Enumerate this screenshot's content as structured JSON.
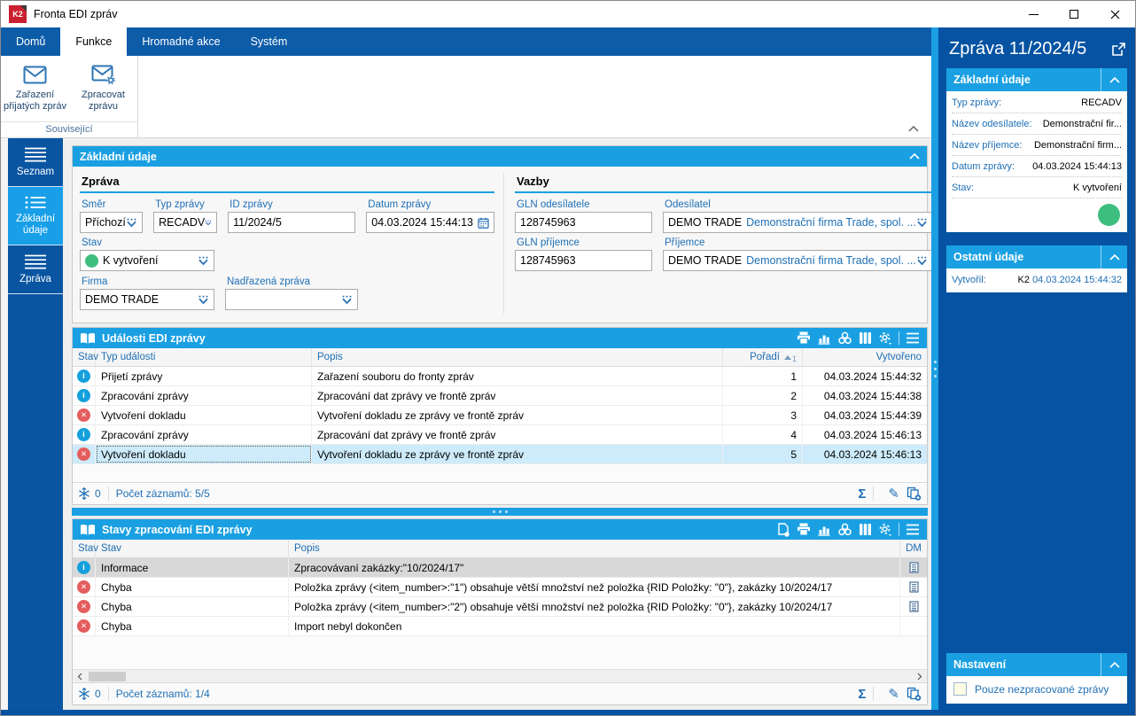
{
  "window": {
    "title": "Fronta EDI zpráv",
    "logo": "K2"
  },
  "ribbon": {
    "tabs": [
      {
        "label": "Domů",
        "active": false
      },
      {
        "label": "Funkce",
        "active": true
      },
      {
        "label": "Hromadné akce",
        "active": false
      },
      {
        "label": "Systém",
        "active": false
      }
    ],
    "group": {
      "label": "Související",
      "buttons": [
        {
          "label": "Zařazení přijatých zpráv",
          "icon": "envelope-icon"
        },
        {
          "label": "Zpracovat zprávu",
          "icon": "envelope-gear-icon"
        }
      ]
    }
  },
  "sidebar": {
    "items": [
      {
        "label": "Seznam",
        "icon": "menu-lines-icon",
        "active": false
      },
      {
        "label": "Základní údaje",
        "icon": "list-dots-icon",
        "active": true
      },
      {
        "label": "Zpráva",
        "icon": "menu-lines-icon",
        "active": false
      }
    ]
  },
  "form": {
    "title": "Základní údaje",
    "zprava": {
      "title": "Zpráva",
      "smer": {
        "label": "Směr",
        "value": "Příchozí"
      },
      "typ": {
        "label": "Typ zprávy",
        "value": "RECADV"
      },
      "id": {
        "label": "ID zprávy",
        "value": "11/2024/5"
      },
      "datum": {
        "label": "Datum zprávy",
        "value": "04.03.2024 15:44:13"
      },
      "stav": {
        "label": "Stav",
        "value": "K vytvoření",
        "status_color": "#3EBE7E"
      },
      "firma": {
        "label": "Firma",
        "value": "DEMO TRADE"
      },
      "nadrazena": {
        "label": "Nadřazená zpráva",
        "value": ""
      }
    },
    "vazby": {
      "title": "Vazby",
      "gln_odesilatele": {
        "label": "GLN odesílatele",
        "value": "128745963"
      },
      "odesilatel": {
        "label": "Odesílatel",
        "code": "DEMO TRADE",
        "name": "Demonstrační firma Trade, spol. ..."
      },
      "gln_prijemce": {
        "label": "GLN příjemce",
        "value": "128745963"
      },
      "prijemce": {
        "label": "Příjemce",
        "code": "DEMO TRADE",
        "name": "Demonstrační firma Trade, spol. ..."
      }
    }
  },
  "events_table": {
    "title": "Události EDI zprávy",
    "headers": {
      "stav": "Stav",
      "typ": "Typ události",
      "popis": "Popis",
      "poradi": "Pořadí",
      "vytvoreno": "Vytvořeno"
    },
    "sort_order": "1",
    "rows": [
      {
        "status": "info",
        "typ": "Přijetí zprávy",
        "popis": "Zařazení souboru do fronty zpráv",
        "poradi": "1",
        "vytvoreno": "04.03.2024 15:44:32",
        "selected": false
      },
      {
        "status": "info",
        "typ": "Zpracování zprávy",
        "popis": "Zpracování dat zprávy ve frontě zpráv",
        "poradi": "2",
        "vytvoreno": "04.03.2024 15:44:38",
        "selected": false
      },
      {
        "status": "error",
        "typ": "Vytvoření dokladu",
        "popis": "Vytvoření dokladu ze zprávy ve frontě zpráv",
        "poradi": "3",
        "vytvoreno": "04.03.2024 15:44:39",
        "selected": false
      },
      {
        "status": "info",
        "typ": "Zpracování zprávy",
        "popis": "Zpracování dat zprávy ve frontě zpráv",
        "poradi": "4",
        "vytvoreno": "04.03.2024 15:46:13",
        "selected": false
      },
      {
        "status": "error",
        "typ": "Vytvoření dokladu",
        "popis": "Vytvoření dokladu ze zprávy ve frontě zpráv",
        "poradi": "5",
        "vytvoreno": "04.03.2024 15:46:13",
        "selected": true
      }
    ],
    "footer": {
      "counter": "0",
      "records": "Počet záznamů: 5/5"
    },
    "toolbar_icons": [
      "printer-icon",
      "chart-icon",
      "wheel-icon",
      "columns-icon",
      "gear-icon",
      "menu-icon"
    ]
  },
  "states_table": {
    "title": "Stavy zpracování EDI zprávy",
    "headers": {
      "stav1": "Stav",
      "stav2": "Stav",
      "popis": "Popis",
      "dm": "DM"
    },
    "rows": [
      {
        "status": "info",
        "stav": "Informace",
        "popis": "Zpracovávaní zakázky:\"10/2024/17\"",
        "dm": true,
        "selected": true
      },
      {
        "status": "error",
        "stav": "Chyba",
        "popis": "Položka zprávy (<item_number>:\"1\") obsahuje větší množství než položka {RID Položky: \"0\"},  zakázky 10/2024/17",
        "dm": true,
        "selected": false
      },
      {
        "status": "error",
        "stav": "Chyba",
        "popis": "Položka zprávy (<item_number>:\"2\") obsahuje větší množství než položka {RID Položky: \"0\"},  zakázky 10/2024/17",
        "dm": true,
        "selected": false
      },
      {
        "status": "error",
        "stav": "Chyba",
        "popis": "Import nebyl dokončen",
        "dm": false,
        "selected": false
      }
    ],
    "footer": {
      "counter": "0",
      "records": "Počet záznamů: 1/4"
    },
    "toolbar_icons": [
      "document-export-icon",
      "printer-icon",
      "chart-icon",
      "wheel-icon",
      "columns-icon",
      "gear-icon",
      "menu-icon"
    ]
  },
  "right_panel": {
    "title": "Zpráva 11/2024/5",
    "zakladni": {
      "title": "Základní údaje",
      "rows": [
        {
          "label": "Typ zprávy:",
          "value": "RECADV"
        },
        {
          "label": "Název odesílatele:",
          "value": "Demonstrační fir..."
        },
        {
          "label": "Název příjemce:",
          "value": "Demonstrační firm..."
        },
        {
          "label": "Datum zprávy:",
          "value": "04.03.2024 15:44:13"
        },
        {
          "label": "Stav:",
          "value": "K vytvoření"
        }
      ],
      "status_color": "#3EBE7E"
    },
    "ostatni": {
      "title": "Ostatní údaje",
      "vytvoril": {
        "label": "Vytvořil:",
        "user": "K2",
        "timestamp": "04.03.2024 15:44:32"
      }
    },
    "nastaveni": {
      "title": "Nastavení",
      "checkbox_label": "Pouze nezpracované zprávy",
      "checked": false
    }
  },
  "colors": {
    "cyan_accent": "#1AA0E2",
    "dark_blue": "#0D5CA8",
    "panel_blue": "#0553A2",
    "label_blue": "#1E6FB5",
    "status_green": "#3EBE7E",
    "status_info": "#14A0DC",
    "status_error": "#E45D5D"
  }
}
